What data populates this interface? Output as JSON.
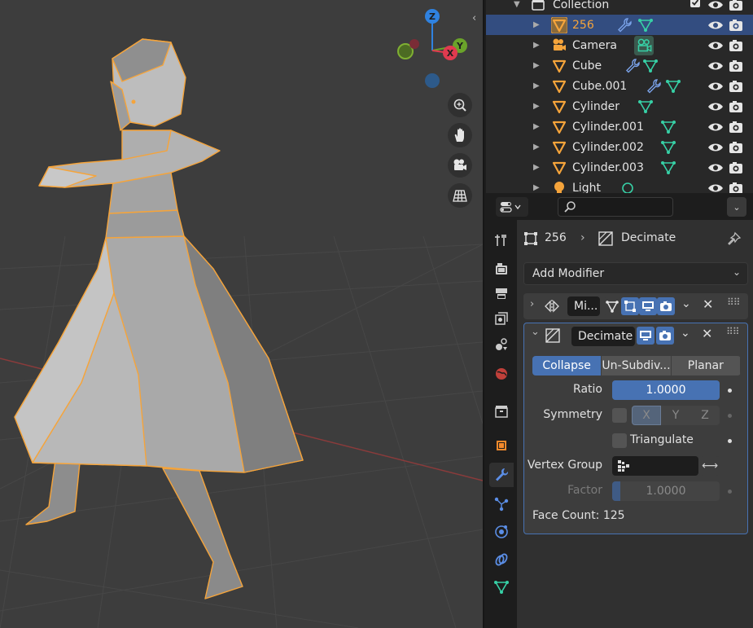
{
  "viewport": {
    "gizmo": {
      "z": "Z",
      "y": "Y",
      "x": "X"
    },
    "nav_buttons": [
      "zoom-icon",
      "hand-pan-icon",
      "camera-view-icon",
      "grid-ortho-icon"
    ],
    "colors": {
      "background": "#3d3d3d",
      "selection_outline": "#f5a43b",
      "mesh": "#8f8f8f",
      "axis_red": "#b8403f"
    }
  },
  "outliner": {
    "collection": "Collection",
    "items": [
      {
        "name": "256",
        "type": "mesh",
        "modifier": true,
        "selected": true
      },
      {
        "name": "Camera",
        "type": "camera",
        "modifier": false,
        "selected": false
      },
      {
        "name": "Cube",
        "type": "mesh",
        "modifier": true,
        "selected": false
      },
      {
        "name": "Cube.001",
        "type": "mesh",
        "modifier": true,
        "selected": false
      },
      {
        "name": "Cylinder",
        "type": "mesh",
        "modifier": false,
        "selected": false
      },
      {
        "name": "Cylinder.001",
        "type": "mesh",
        "modifier": false,
        "selected": false
      },
      {
        "name": "Cylinder.002",
        "type": "mesh",
        "modifier": false,
        "selected": false
      },
      {
        "name": "Cylinder.003",
        "type": "mesh",
        "modifier": false,
        "selected": false
      },
      {
        "name": "Light",
        "type": "light",
        "modifier": false,
        "selected": false
      }
    ]
  },
  "properties": {
    "breadcrumb": {
      "object": "256",
      "modifier": "Decimate"
    },
    "add_modifier": "Add Modifier",
    "mirror_modifier": {
      "name": "Mi..."
    },
    "decimate": {
      "name": "Decimate",
      "modes": [
        "Collapse",
        "Un-Subdiv...",
        "Planar"
      ],
      "active_mode": "Collapse",
      "ratio_label": "Ratio",
      "ratio": "1.0000",
      "ratio_fraction": 1.0,
      "symmetry_label": "Symmetry",
      "axes": [
        "X",
        "Y",
        "Z"
      ],
      "triangulate_label": "Triangulate",
      "vertex_group_label": "Vertex Group",
      "factor_label": "Factor",
      "factor": "1.0000",
      "face_count": "Face Count: 125"
    },
    "tabs": [
      "tool",
      "render",
      "output",
      "view-layer",
      "scene",
      "world",
      "collection",
      "object",
      "modifiers",
      "particles",
      "physics",
      "constraints",
      "data"
    ],
    "active_tab": "modifiers"
  }
}
